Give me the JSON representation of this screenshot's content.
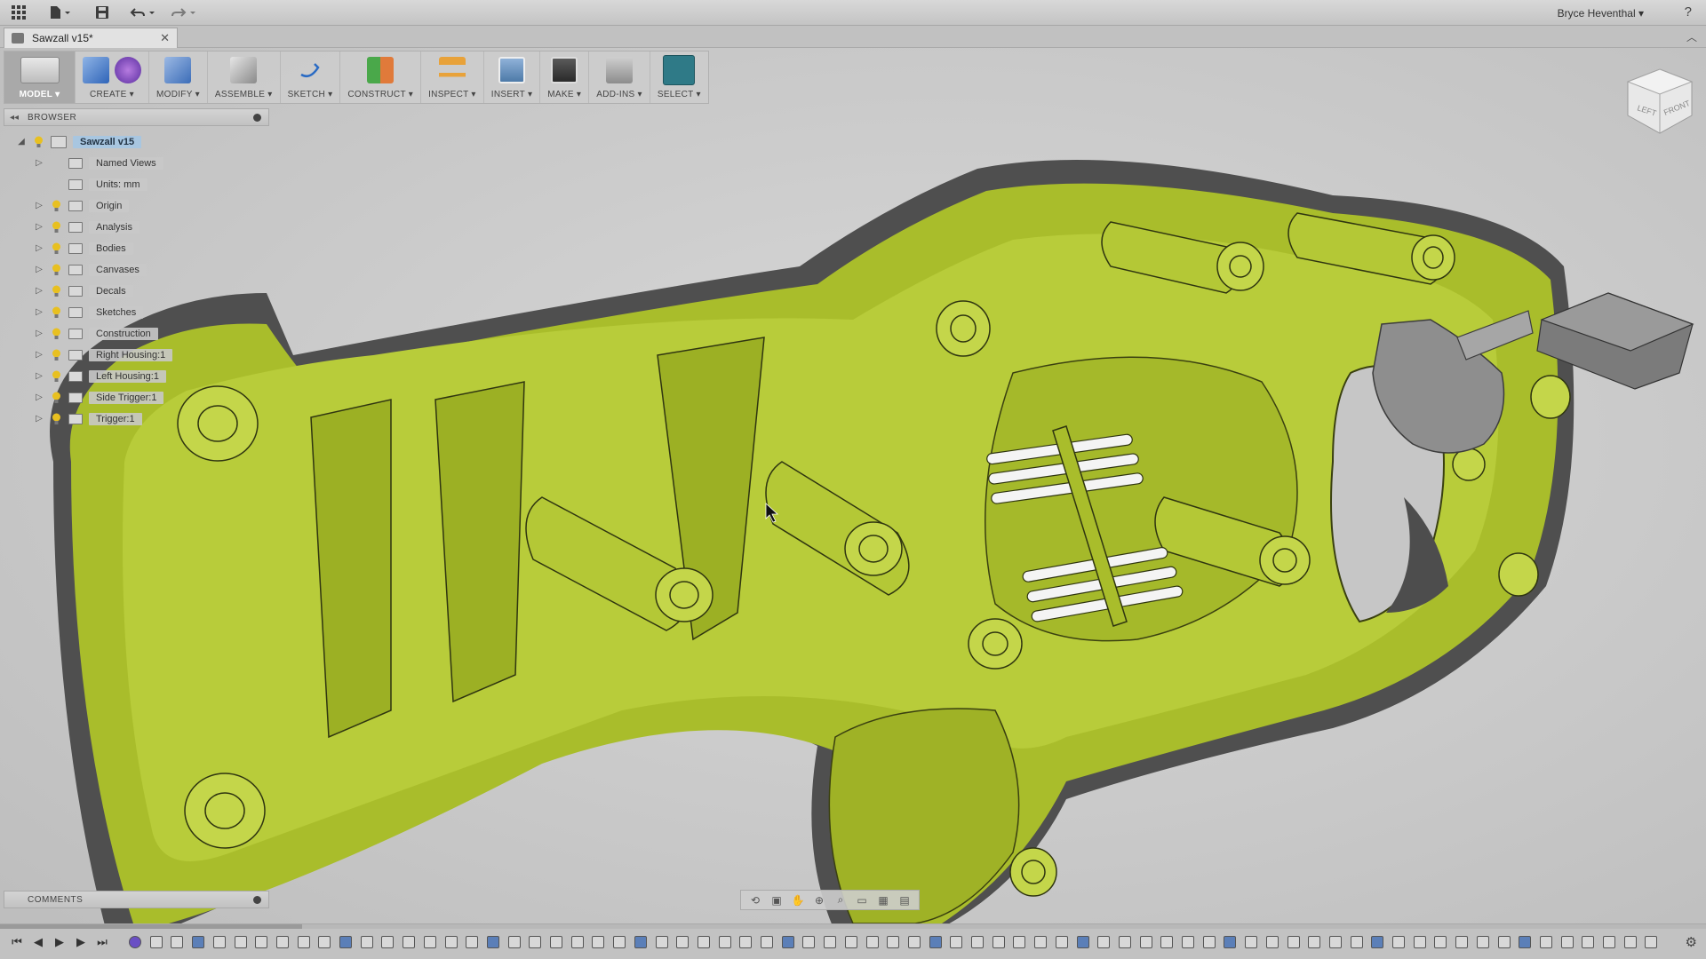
{
  "app": {
    "user_name": "Bryce Heventhal ▾",
    "help": "?"
  },
  "tab": {
    "document_name": "Sawzall v15*"
  },
  "toolbar": [
    {
      "id": "model",
      "label": "MODEL ▾"
    },
    {
      "id": "create",
      "label": "CREATE ▾"
    },
    {
      "id": "modify",
      "label": "MODIFY ▾"
    },
    {
      "id": "assemble",
      "label": "ASSEMBLE ▾"
    },
    {
      "id": "sketch",
      "label": "SKETCH ▾"
    },
    {
      "id": "construct",
      "label": "CONSTRUCT ▾"
    },
    {
      "id": "inspect",
      "label": "INSPECT ▾"
    },
    {
      "id": "insert",
      "label": "INSERT ▾"
    },
    {
      "id": "make",
      "label": "MAKE ▾"
    },
    {
      "id": "addins",
      "label": "ADD-INS ▾"
    },
    {
      "id": "select",
      "label": "SELECT ▾"
    }
  ],
  "browser": {
    "title": "BROWSER",
    "root": "Sawzall v15",
    "items": [
      {
        "label": "Named Views",
        "has_bulb": false
      },
      {
        "label": "Units: mm",
        "has_bulb": false
      },
      {
        "label": "Origin",
        "has_bulb": true
      },
      {
        "label": "Analysis",
        "has_bulb": true
      },
      {
        "label": "Bodies",
        "has_bulb": true
      },
      {
        "label": "Canvases",
        "has_bulb": true
      },
      {
        "label": "Decals",
        "has_bulb": true
      },
      {
        "label": "Sketches",
        "has_bulb": true
      },
      {
        "label": "Construction",
        "has_bulb": true
      },
      {
        "label": "Right Housing:1",
        "has_bulb": true
      },
      {
        "label": "Left Housing:1",
        "has_bulb": true
      },
      {
        "label": "Side Trigger:1",
        "has_bulb": true
      },
      {
        "label": "Trigger:1",
        "has_bulb": true
      }
    ]
  },
  "comments": {
    "title": "COMMENTS"
  },
  "viewcube": {
    "left_face": "LEFT",
    "front_face": "FRONT"
  },
  "colors": {
    "model_body": "#a9bd2b",
    "model_shadow": "#4f4f4f",
    "trigger": "#8e8e8e",
    "root_highlight": "#a8c6e0"
  }
}
